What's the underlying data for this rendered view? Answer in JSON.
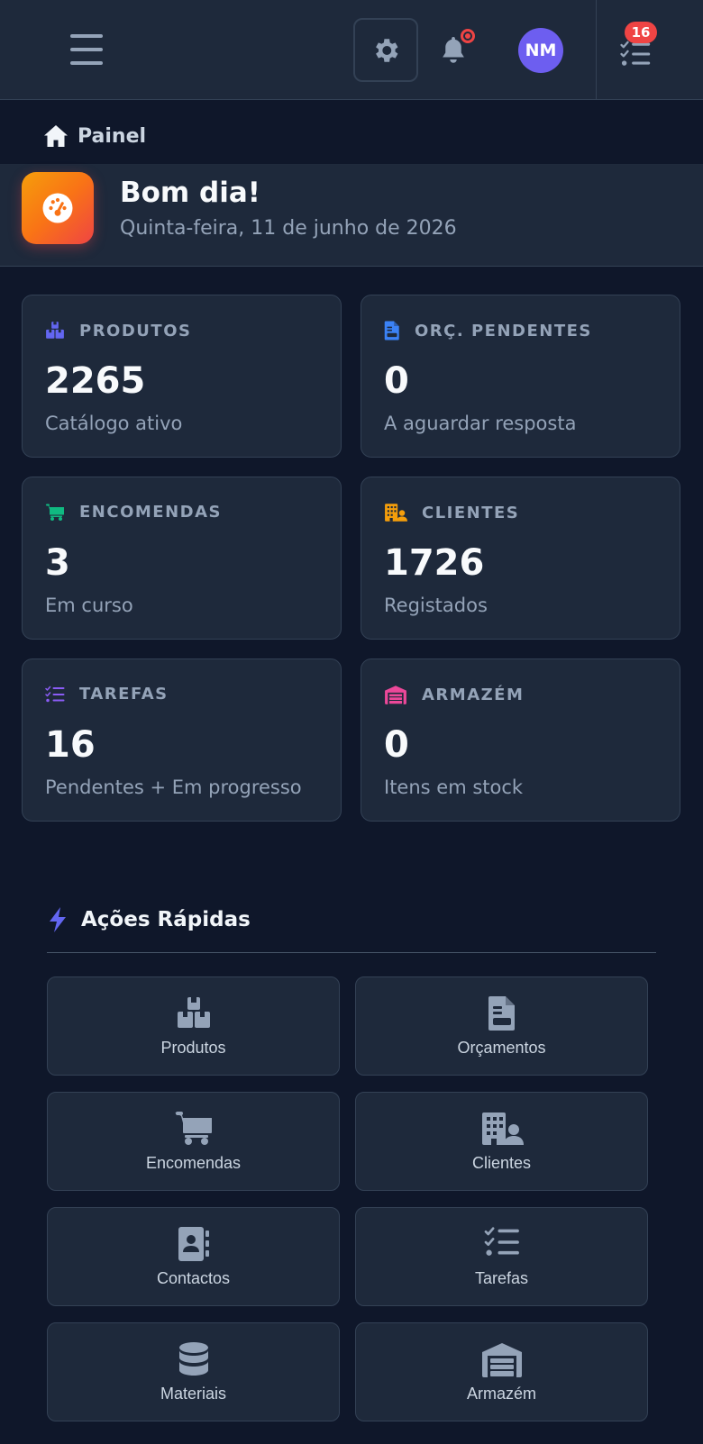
{
  "header": {
    "menu_icon": "hamburger-icon",
    "settings_icon": "gear-icon",
    "notifications_icon": "bell-icon",
    "avatar_initials": "NM",
    "tasks_icon": "task-list-icon",
    "tasks_badge": "16"
  },
  "breadcrumb": {
    "icon": "home-icon",
    "label": "Painel"
  },
  "greeting": {
    "icon": "gauge-icon",
    "title": "Bom dia!",
    "date": "Quinta-feira, 11 de junho de 2026"
  },
  "stats": [
    {
      "label": "PRODUTOS",
      "value": "2265",
      "sub": "Catálogo ativo",
      "icon": "boxes-icon",
      "color": "#6366f1"
    },
    {
      "label": "ORÇ. PENDENTES",
      "value": "0",
      "sub": "A aguardar resposta",
      "icon": "document-icon",
      "color": "#3b82f6"
    },
    {
      "label": "ENCOMENDAS",
      "value": "3",
      "sub": "Em curso",
      "icon": "cart-icon",
      "color": "#10b981"
    },
    {
      "label": "CLIENTES",
      "value": "1726",
      "sub": "Registados",
      "icon": "building-user-icon",
      "color": "#f59e0b"
    },
    {
      "label": "TAREFAS",
      "value": "16",
      "sub": "Pendentes + Em progresso",
      "icon": "task-list-icon",
      "color": "#8b5cf6"
    },
    {
      "label": "ARMAZÉM",
      "value": "0",
      "sub": "Itens em stock",
      "icon": "warehouse-icon",
      "color": "#ec4899"
    }
  ],
  "quick_actions": {
    "icon": "bolt-icon",
    "title": "Ações Rápidas",
    "items": [
      {
        "label": "Produtos",
        "icon": "boxes-icon"
      },
      {
        "label": "Orçamentos",
        "icon": "document-icon"
      },
      {
        "label": "Encomendas",
        "icon": "cart-icon"
      },
      {
        "label": "Clientes",
        "icon": "building-user-icon"
      },
      {
        "label": "Contactos",
        "icon": "address-book-icon"
      },
      {
        "label": "Tarefas",
        "icon": "task-list-icon"
      },
      {
        "label": "Materiais",
        "icon": "database-icon"
      },
      {
        "label": "Armazém",
        "icon": "warehouse-icon"
      }
    ]
  },
  "colors": {
    "background": "#0f172a",
    "surface": "#1e293b",
    "border": "#334155",
    "accent": "#6366f1",
    "badge": "#ef4444",
    "avatar": "#6d5ef0"
  }
}
